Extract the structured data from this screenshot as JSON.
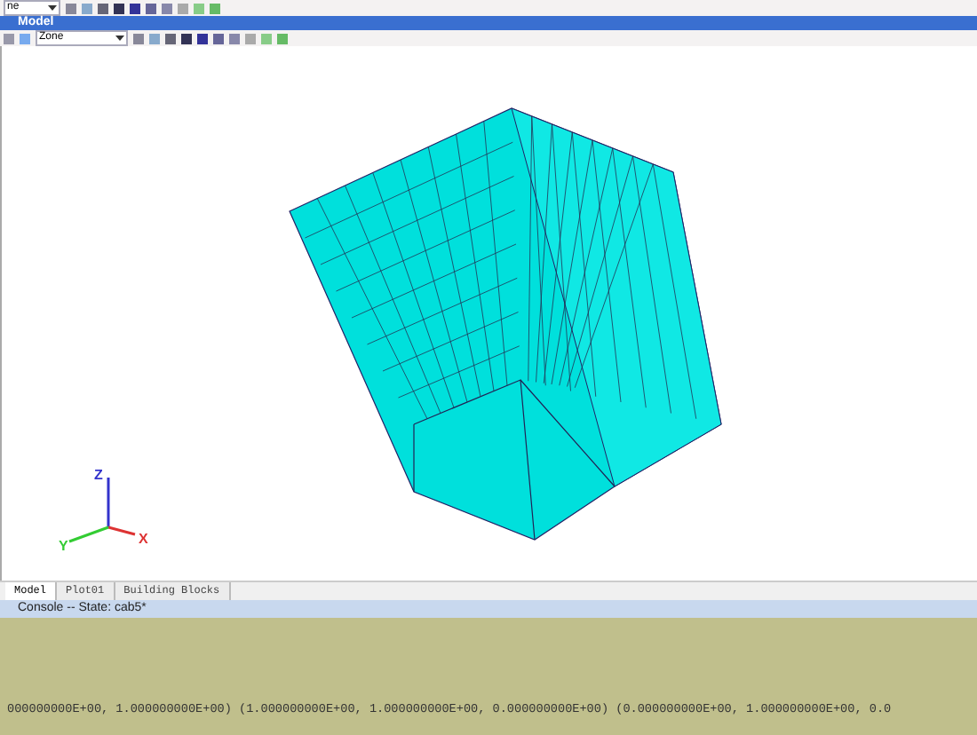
{
  "top_toolbar": {
    "dropdown": "ne"
  },
  "window": {
    "title": "Model"
  },
  "model_toolbar": {
    "dropdown": "Zone"
  },
  "tabs": [
    {
      "label": "Model",
      "selected": true
    },
    {
      "label": "Plot01",
      "selected": false
    },
    {
      "label": "Building Blocks",
      "selected": false
    }
  ],
  "axes": {
    "z": "Z",
    "y": "Y",
    "x": "X"
  },
  "console": {
    "title": "Console -- State: cab5*",
    "line": "000000000E+00, 1.000000000E+00) (1.000000000E+00, 1.000000000E+00, 0.000000000E+00) (0.000000000E+00, 1.000000000E+00, 0.0"
  }
}
